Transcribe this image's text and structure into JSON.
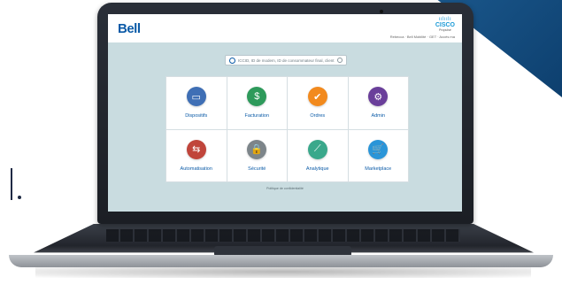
{
  "brand": {
    "bell_logo": "Bell",
    "cisco_bars": "ıılıılı",
    "cisco_word": "CISCO",
    "cisco_sub": "Propulsé"
  },
  "header": {
    "links": "Rebecca  ∙  Bell Mobilité  ·  GET  ·  Accès ma"
  },
  "search": {
    "placeholder": "ICCID, ID de modem, ID de consommateur final, client"
  },
  "tiles": [
    {
      "label": "Dispositifs",
      "icon": "sim-card-icon",
      "glyph": "▭",
      "color": "#3f6fb5"
    },
    {
      "label": "Facturation",
      "icon": "dollar-icon",
      "glyph": "$",
      "color": "#2e9a5b"
    },
    {
      "label": "Ordres",
      "icon": "checklist-icon",
      "glyph": "✔",
      "color": "#f28a1e"
    },
    {
      "label": "Admin",
      "icon": "gear-icon",
      "glyph": "⚙",
      "color": "#6a3f9a"
    },
    {
      "label": "Automatisation",
      "icon": "arrows-exchange-icon",
      "glyph": "⇆",
      "color": "#c0453b"
    },
    {
      "label": "Sécurité",
      "icon": "lock-icon",
      "glyph": "🔒",
      "color": "#7d858a"
    },
    {
      "label": "Analytique",
      "icon": "chart-icon",
      "glyph": "⟋",
      "color": "#3aa88b"
    },
    {
      "label": "Marketplace",
      "icon": "cart-icon",
      "glyph": "🛒",
      "color": "#2a95d8"
    }
  ],
  "footer": {
    "privacy": "Politique de confidentialité"
  }
}
